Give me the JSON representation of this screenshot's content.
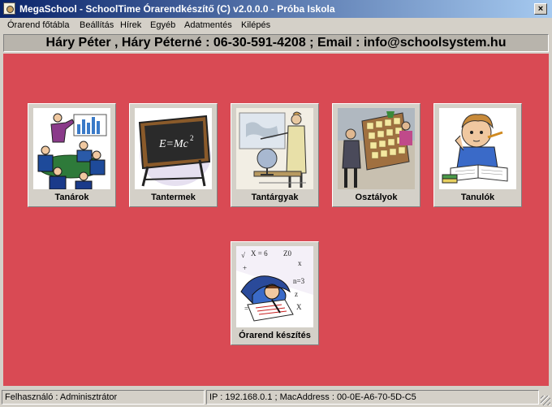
{
  "window": {
    "title": "MegaSchool - SchoolTime Órarendkészítő (C) v2.0.0.0 - Próba Iskola",
    "close_glyph": "×"
  },
  "menu": {
    "items": [
      {
        "label": "Órarend főtábla"
      },
      {
        "label": "Beállítás"
      },
      {
        "label": "Hírek"
      },
      {
        "label": "Egyéb"
      },
      {
        "label": "Adatmentés"
      },
      {
        "label": "Kilépés"
      }
    ]
  },
  "contact": {
    "text": "Háry Péter , Háry Péterné : 06-30-591-4208  ;  Email : info@schoolsystem.hu"
  },
  "modules": [
    {
      "label": "Tanárok",
      "icon": "teachers-meeting-icon"
    },
    {
      "label": "Tantermek",
      "icon": "chalkboard-icon"
    },
    {
      "label": "Tantárgyak",
      "icon": "teacher-globe-icon"
    },
    {
      "label": "Osztályok",
      "icon": "class-board-icon"
    },
    {
      "label": "Tanulók",
      "icon": "student-reading-icon"
    },
    {
      "label": "Órarend készítés",
      "icon": "timetable-maker-icon"
    }
  ],
  "status": {
    "user": "Felhasználó : Adminisztrátor",
    "network": "IP : 192.168.0.1 ; MacAddress : 00-0E-A6-70-5D-C5"
  },
  "colors": {
    "title_bar_start": "#0a246a",
    "title_bar_end": "#a6caf0",
    "main_background": "#d94a54",
    "chrome": "#d4d0c8"
  }
}
